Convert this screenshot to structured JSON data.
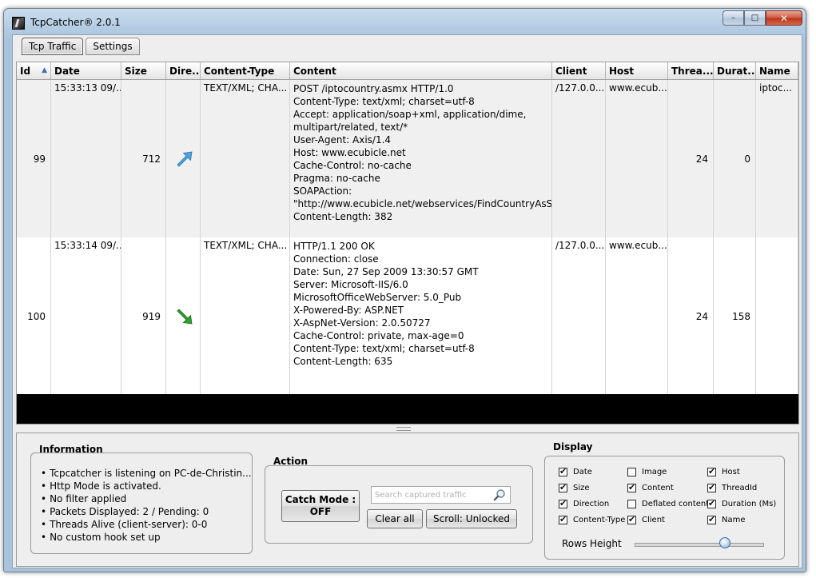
{
  "window": {
    "title": "TcpCatcher® 2.0.1",
    "controls": {
      "minimize": "–",
      "maximize": "□",
      "close": "✕"
    }
  },
  "tabs": [
    {
      "label": "Tcp Traffic",
      "active": true
    },
    {
      "label": "Settings",
      "active": false
    }
  ],
  "table": {
    "columns": [
      "Id",
      "Date",
      "Size",
      "Dire...",
      "Content-Type",
      "Content",
      "Client",
      "Host",
      "Threa...",
      "Durat...",
      "Name"
    ],
    "sort_indicator": "▲",
    "rows": [
      {
        "id": "99",
        "date": "15:33:13 09/...",
        "size": "712",
        "direction": "outgoing-arrow-icon",
        "content_type": "TEXT/XML; CHA...",
        "content": [
          "POST /iptocountry.asmx HTTP/1.0",
          "Content-Type: text/xml; charset=utf-8",
          "Accept: application/soap+xml, application/dime,",
          "multipart/related, text/*",
          "User-Agent: Axis/1.4",
          "Host: www.ecubicle.net",
          "Cache-Control: no-cache",
          "Pragma: no-cache",
          "SOAPAction:",
          "\"http://www.ecubicle.net/webservices/FindCountryAsString\"",
          "Content-Length: 382"
        ],
        "client": "/127.0.0....",
        "host": "www.ecub...",
        "thread": "24",
        "duration": "0",
        "name": "iptoc..."
      },
      {
        "id": "100",
        "date": "15:33:14 09/...",
        "size": "919",
        "direction": "incoming-arrow-icon",
        "content_type": "TEXT/XML; CHA...",
        "content": [
          "HTTP/1.1 200 OK",
          "Connection: close",
          "Date: Sun, 27 Sep 2009 13:30:57 GMT",
          "Server: Microsoft-IIS/6.0",
          "MicrosoftOfficeWebServer: 5.0_Pub",
          "X-Powered-By: ASP.NET",
          "X-AspNet-Version: 2.0.50727",
          "Cache-Control: private, max-age=0",
          "Content-Type: text/xml; charset=utf-8",
          "Content-Length: 635"
        ],
        "client": "/127.0.0....",
        "host": "www.ecub...",
        "thread": "24",
        "duration": "158",
        "name": ""
      }
    ]
  },
  "information": {
    "label": "Information",
    "items": [
      "Tcpcatcher is listening on PC-de-Christin...",
      "Http Mode is activated.",
      "No filter applied",
      "Packets Displayed: 2 / Pending: 0",
      "Threads Alive (client-server): 0-0",
      "No custom hook set up"
    ]
  },
  "action": {
    "label": "Action",
    "catch_mode_line1": "Catch Mode :",
    "catch_mode_line2": "OFF",
    "search_placeholder": "Search captured traffic",
    "clear_all": "Clear all",
    "scroll": "Scroll: Unlocked"
  },
  "display": {
    "label": "Display",
    "options": [
      {
        "label": "Date",
        "checked": true
      },
      {
        "label": "Image",
        "checked": false
      },
      {
        "label": "Host",
        "checked": true
      },
      {
        "label": "Size",
        "checked": true
      },
      {
        "label": "Content",
        "checked": true
      },
      {
        "label": "ThreadId",
        "checked": true
      },
      {
        "label": "Direction",
        "checked": true
      },
      {
        "label": "Deflated content",
        "checked": false
      },
      {
        "label": "Duration (Ms)",
        "checked": true
      },
      {
        "label": "Content-Type",
        "checked": true
      },
      {
        "label": "Client",
        "checked": true
      },
      {
        "label": "Name",
        "checked": true
      }
    ],
    "rows_height_label": "Rows Height",
    "rows_height_level": 0.7
  },
  "colors": {
    "outgoing_arrow": "#4aa3df",
    "incoming_arrow": "#2e9e2e"
  }
}
